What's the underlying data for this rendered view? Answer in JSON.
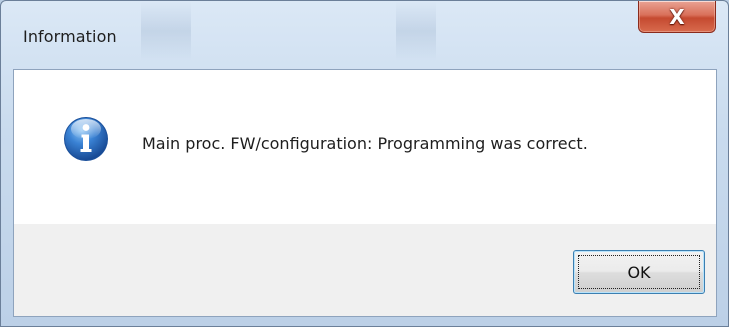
{
  "window": {
    "title": "Information",
    "close_glyph": "X"
  },
  "message": {
    "icon": "info-icon",
    "text": "Main proc. FW/configuration: Programming was correct."
  },
  "buttons": {
    "ok_label": "OK"
  },
  "colors": {
    "close_button": "#c54a30",
    "info_icon_blue": "#1f5fb0",
    "content_background": "#ffffff",
    "footer_background": "#f0f0f0"
  }
}
